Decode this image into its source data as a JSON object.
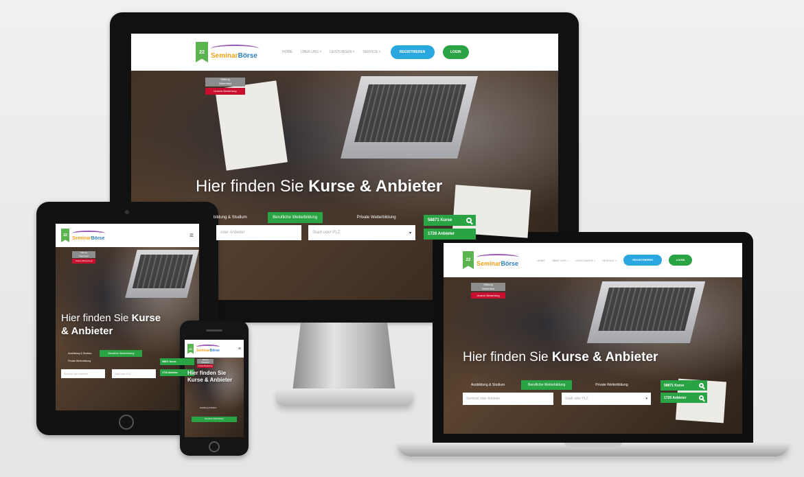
{
  "site": {
    "logo_badge": "22",
    "logo_text_a": "Seminar",
    "logo_text_b": "Börse",
    "nav": {
      "home": "HOME",
      "about": "ÜBER UNS ˅",
      "services": "LEISTUNGEN ˅",
      "service": "SERVICE ˅",
      "register": "REGISTRIEREN",
      "login": "LOGIN"
    },
    "hero": {
      "badge_top": "Stiftung\nWarentest",
      "badge_red": "Unsere Bewertung",
      "title_regular": "Hier finden Sie ",
      "title_bold": "Kurse & Anbieter",
      "title_bold_line1": "Kurse",
      "title_bold_line2": "& Anbieter",
      "tab_left": "Ausbildung & Studium",
      "tab_left_short": "bildung & Studium",
      "tab_active": "Berufliche Weiterbildung",
      "tab_right": "Private Weiterbildung",
      "field_search": "Seminar oder Anbieter",
      "field_search_short": "oder Anbieter",
      "field_city": "Stadt oder PLZ",
      "courses_count": "58871 Kurse",
      "providers_count": "1726 Anbieter"
    }
  },
  "colors": {
    "green": "#2aa345",
    "blue": "#29a8e0",
    "red": "#c8102e"
  }
}
